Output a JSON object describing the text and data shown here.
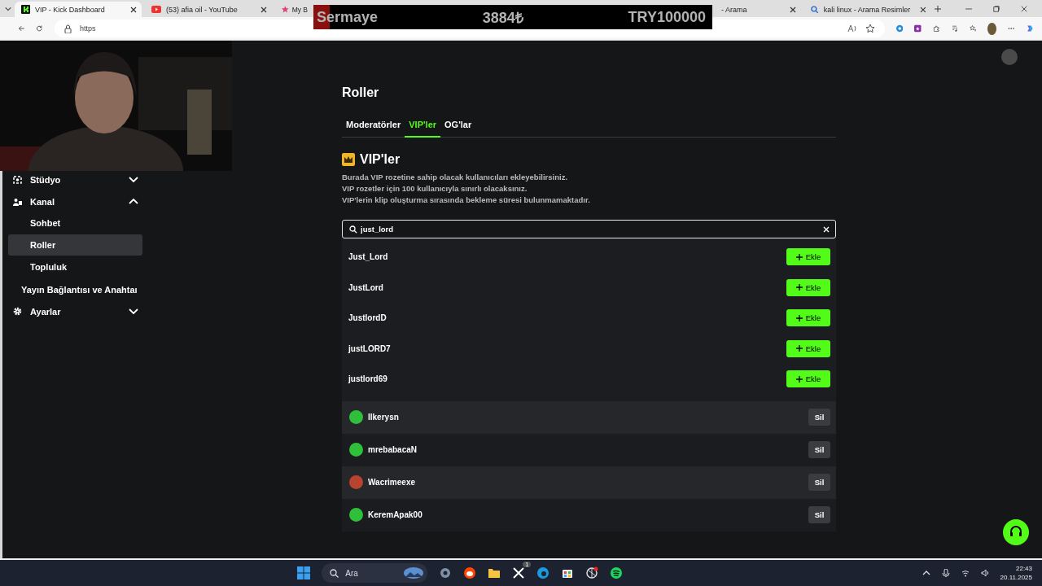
{
  "browser": {
    "tabs": [
      {
        "title": "VIP - Kick Dashboard",
        "selected": true
      },
      {
        "title": "(53) afia oil - YouTube",
        "selected": false
      },
      {
        "title": "My B",
        "selected": false
      },
      {
        "title": "- Arama",
        "selected": false
      },
      {
        "title": "kali linux - Arama Resimler",
        "selected": false
      }
    ],
    "url": "https"
  },
  "overlay": {
    "label": "Sermaye",
    "amount": "3884₺",
    "target": "TRY100000"
  },
  "sidebar": {
    "items": [
      {
        "label": "Stüdyo",
        "kind": "group",
        "expanded": false
      },
      {
        "label": "Kanal",
        "kind": "group",
        "expanded": true,
        "children": [
          {
            "label": "Sohbet",
            "selected": false
          },
          {
            "label": "Roller",
            "selected": true
          },
          {
            "label": "Topluluk",
            "selected": false
          }
        ]
      },
      {
        "label": "Yayın Bağlantısı ve Anahtaı",
        "kind": "link"
      },
      {
        "label": "Ayarlar",
        "kind": "group",
        "expanded": false
      }
    ]
  },
  "page": {
    "title": "Roller",
    "tabs": [
      {
        "label": "Moderatörler",
        "selected": false
      },
      {
        "label": "VIP'ler",
        "selected": true
      },
      {
        "label": "OG'lar",
        "selected": false
      }
    ],
    "section": {
      "title": "VIP'ler",
      "description": [
        "Burada VIP rozetine sahip olacak kullanıcıları ekleyebilirsiniz.",
        "VIP rozetler için 100 kullanıcıyla sınırlı olacaksınız.",
        "VIP'lerin klip oluşturma sırasında bekleme süresi bulunmamaktadır."
      ]
    },
    "search": {
      "value": "just_lord"
    },
    "results": [
      {
        "name": "Just_Lord",
        "action": "Ekle"
      },
      {
        "name": "JustLord",
        "action": "Ekle"
      },
      {
        "name": "JustlordD",
        "action": "Ekle"
      },
      {
        "name": "justLORD7",
        "action": "Ekle"
      },
      {
        "name": "justlord69",
        "action": "Ekle"
      }
    ],
    "members": [
      {
        "name": "Ilkerysn",
        "color": "#2fbf3a",
        "action": "Sil"
      },
      {
        "name": "mrebabacaN",
        "color": "#2fbf3a",
        "action": "Sil"
      },
      {
        "name": "Wacrimeexe",
        "color": "#b8432f",
        "action": "Sil"
      },
      {
        "name": "KeremApak00",
        "color": "#2fbf3a",
        "action": "Sil"
      }
    ]
  },
  "taskbar": {
    "search": "Ara",
    "badge": "1",
    "time": "22:43",
    "date": "20.11.2025"
  }
}
